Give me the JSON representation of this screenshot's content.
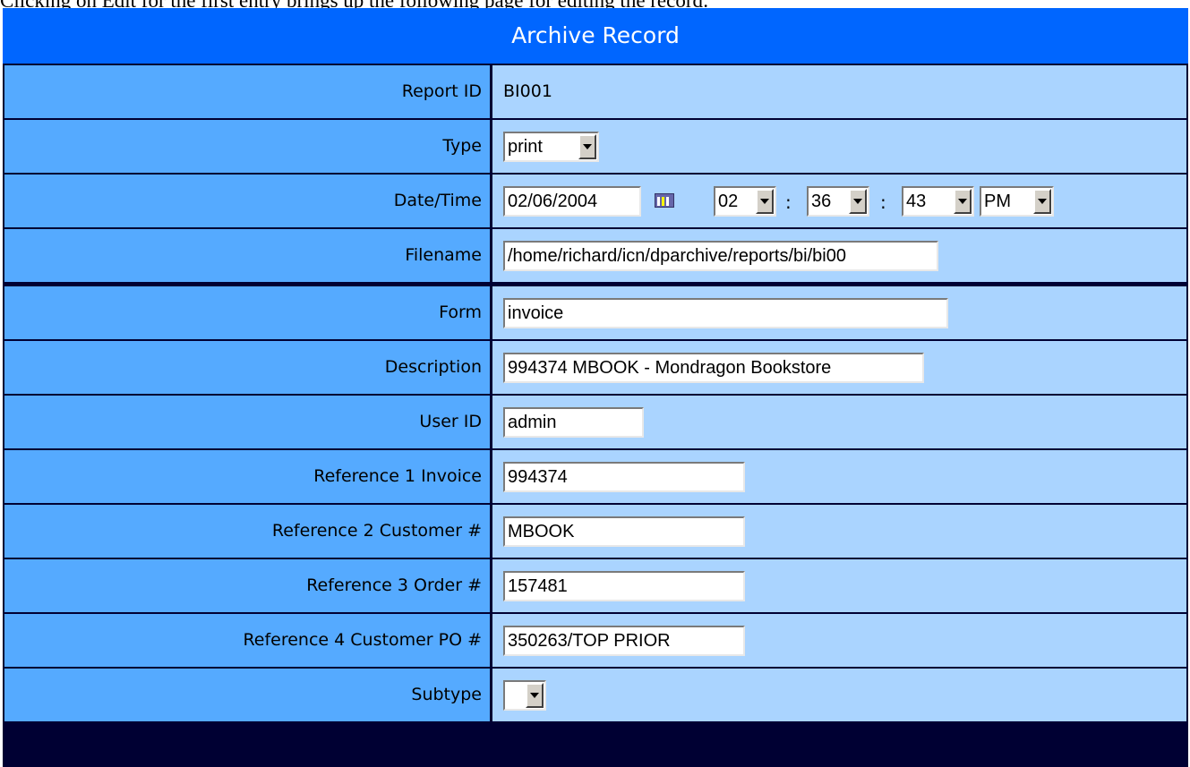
{
  "intro_text": "Clicking on Edit for the first entry brings up the following page for editing the record:",
  "title": "Archive Record",
  "fields": {
    "report_id": {
      "label": "Report ID",
      "value": "BI001"
    },
    "type": {
      "label": "Type",
      "value": "print"
    },
    "datetime": {
      "label": "Date/Time",
      "date": "02/06/2004",
      "hour": "02",
      "minute": "36",
      "second": "43",
      "ampm": "PM",
      "separator": ":",
      "calendar_icon": "calendar-icon"
    },
    "filename": {
      "label": "Filename",
      "value": "/home/richard/icn/dparchive/reports/bi/bi00"
    },
    "form": {
      "label": "Form",
      "value": "invoice"
    },
    "description": {
      "label": "Description",
      "value": "994374  MBOOK - Mondragon Bookstore"
    },
    "user_id": {
      "label": "User ID",
      "value": "admin"
    },
    "reference1": {
      "label": "Reference 1 Invoice",
      "value": "994374"
    },
    "reference2": {
      "label": "Reference 2 Customer #",
      "value": "MBOOK"
    },
    "reference3": {
      "label": "Reference 3 Order #",
      "value": "157481"
    },
    "reference4": {
      "label": "Reference 4 Customer PO #",
      "value": "350263/TOP PRIOR"
    },
    "subtype": {
      "label": "Subtype",
      "value": ""
    }
  },
  "colors": {
    "title_bar": "#0066ff",
    "label_cell": "#55aaff",
    "value_cell": "#aad4ff",
    "grid_lines": "#000033"
  }
}
